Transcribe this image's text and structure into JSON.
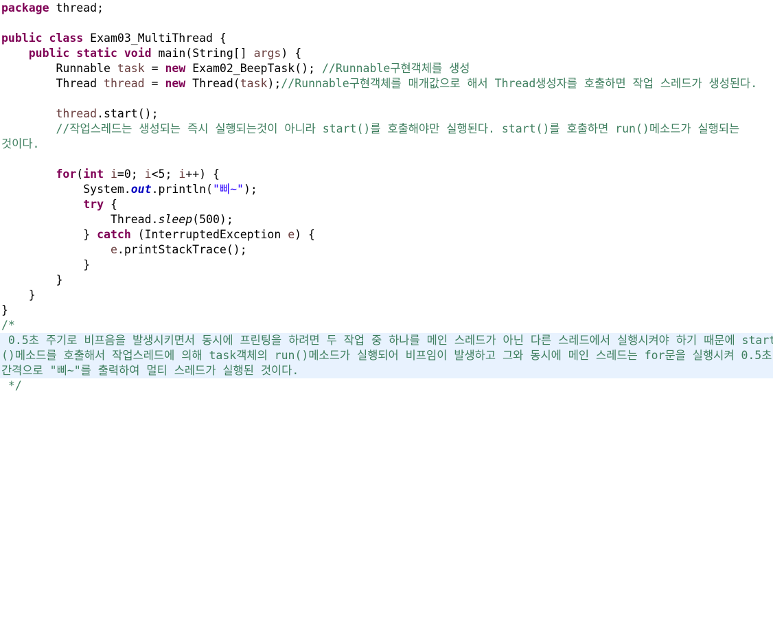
{
  "lines": [
    {
      "row": 0,
      "tokens": [
        {
          "t": "package",
          "c": "kw"
        },
        {
          "t": " thread;"
        }
      ]
    },
    {
      "row": 2,
      "tokens": [
        {
          "t": "public",
          "c": "kw"
        },
        {
          "t": " "
        },
        {
          "t": "class",
          "c": "kw"
        },
        {
          "t": " Exam03_MultiThread {"
        }
      ]
    },
    {
      "row": 3,
      "tokens": [
        {
          "t": "    "
        },
        {
          "t": "public",
          "c": "kw"
        },
        {
          "t": " "
        },
        {
          "t": "static",
          "c": "kw"
        },
        {
          "t": " "
        },
        {
          "t": "void",
          "c": "kw"
        },
        {
          "t": " main(String[] "
        },
        {
          "t": "args",
          "c": "var"
        },
        {
          "t": ") {"
        }
      ]
    },
    {
      "row": 4,
      "tokens": [
        {
          "t": "        Runnable "
        },
        {
          "t": "task",
          "c": "var"
        },
        {
          "t": " = "
        },
        {
          "t": "new",
          "c": "kw"
        },
        {
          "t": " Exam02_BeepTask(); "
        },
        {
          "t": "//Runnable구현객체를 생성",
          "c": "cm"
        }
      ]
    },
    {
      "row": 5,
      "tokens": [
        {
          "t": "        Thread "
        },
        {
          "t": "thread",
          "c": "var"
        },
        {
          "t": " = "
        },
        {
          "t": "new",
          "c": "kw"
        },
        {
          "t": " Thread("
        },
        {
          "t": "task",
          "c": "var"
        },
        {
          "t": ");"
        },
        {
          "t": "//Runnable구현객체를 매개값으로 해서 Thread생성자를 호출하면 작업 스레드가 생성된다.",
          "c": "cm"
        }
      ]
    },
    {
      "row": 7,
      "tokens": [
        {
          "t": "        "
        },
        {
          "t": "thread",
          "c": "var"
        },
        {
          "t": ".start();"
        }
      ]
    },
    {
      "row": 8,
      "tokens": [
        {
          "t": "        "
        },
        {
          "t": "//작업스레드는 생성되는 즉시 실행되는것이 아니라 start()를 호출해야만 실행된다. start()를 호출하면 run()메소드가 실행되는",
          "c": "cm"
        }
      ]
    },
    {
      "row": 9,
      "tokens": [
        {
          "t": "것이다.",
          "c": "cm"
        }
      ]
    },
    {
      "row": 11,
      "tokens": [
        {
          "t": "        "
        },
        {
          "t": "for",
          "c": "kw"
        },
        {
          "t": "("
        },
        {
          "t": "int",
          "c": "kw"
        },
        {
          "t": " "
        },
        {
          "t": "i",
          "c": "var"
        },
        {
          "t": "=0; "
        },
        {
          "t": "i",
          "c": "var"
        },
        {
          "t": "<5; "
        },
        {
          "t": "i",
          "c": "var"
        },
        {
          "t": "++) {"
        }
      ]
    },
    {
      "row": 12,
      "tokens": [
        {
          "t": "            System."
        },
        {
          "t": "out",
          "c": "fld"
        },
        {
          "t": ".println("
        },
        {
          "t": "\"삐~\"",
          "c": "str"
        },
        {
          "t": ");"
        }
      ]
    },
    {
      "row": 13,
      "tokens": [
        {
          "t": "            "
        },
        {
          "t": "try",
          "c": "kw"
        },
        {
          "t": " {"
        }
      ]
    },
    {
      "row": 14,
      "tokens": [
        {
          "t": "                Thread."
        },
        {
          "t": "sleep",
          "c": "it"
        },
        {
          "t": "(500);"
        }
      ]
    },
    {
      "row": 15,
      "tokens": [
        {
          "t": "            } "
        },
        {
          "t": "catch",
          "c": "kw"
        },
        {
          "t": " (InterruptedException "
        },
        {
          "t": "e",
          "c": "var"
        },
        {
          "t": ") {"
        }
      ]
    },
    {
      "row": 16,
      "tokens": [
        {
          "t": "                "
        },
        {
          "t": "e",
          "c": "var"
        },
        {
          "t": ".printStackTrace();"
        }
      ]
    },
    {
      "row": 17,
      "tokens": [
        {
          "t": "            }"
        }
      ]
    },
    {
      "row": 18,
      "tokens": [
        {
          "t": "        }"
        }
      ]
    },
    {
      "row": 19,
      "tokens": [
        {
          "t": "    }"
        }
      ]
    },
    {
      "row": 20,
      "tokens": [
        {
          "t": "}"
        }
      ]
    },
    {
      "row": 21,
      "tokens": [
        {
          "t": "/*",
          "c": "cm"
        }
      ]
    },
    {
      "row": 22,
      "hl": true,
      "tokens": [
        {
          "t": " 0.5초 주기로 비프음을 발생시키면서 동시에 프린팅을 하려면 두 작업 중 하나를 메인 스레드가 아닌 다른 스레드에서 실행시켜야 하기 때문에 start",
          "c": "cm"
        }
      ]
    },
    {
      "row": 23,
      "hl": true,
      "tokens": [
        {
          "t": "()메소드를 호출해서 작업스레드에 의해 task객체의 run()메소드가 실행되어 비프임이 발생하고 그와 동시에 메인 스레드는 for문을 실행시켜 0.5초",
          "c": "cm"
        }
      ]
    },
    {
      "row": 24,
      "hl": true,
      "tokens": [
        {
          "t": "간격으로 \"삐~\"를 출력하여 멀티 스레드가 실행된 것이다.",
          "c": "cm"
        }
      ]
    },
    {
      "row": 25,
      "tokens": [
        {
          "t": " */",
          "c": "cm"
        }
      ]
    }
  ]
}
